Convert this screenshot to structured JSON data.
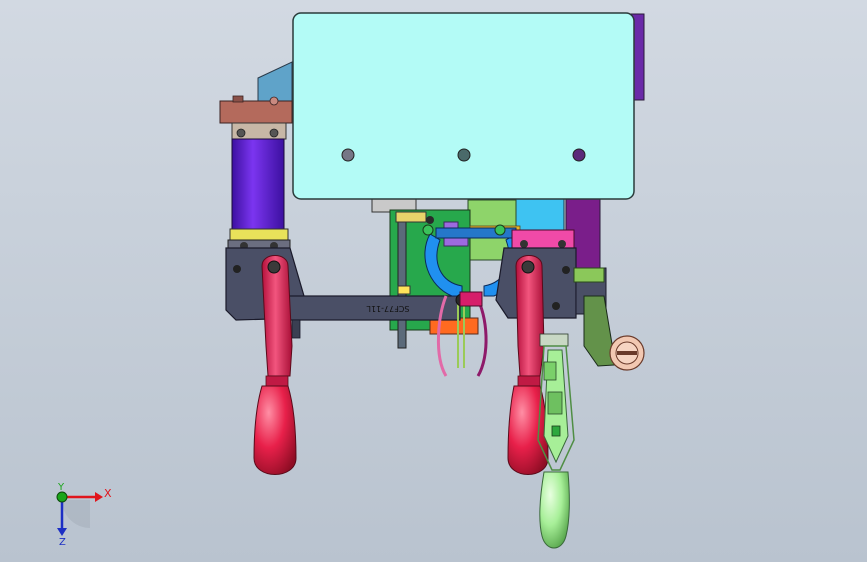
{
  "viewport": {
    "background_top": "#d2d9e2",
    "background_bottom": "#b9c3cf"
  },
  "part_label": "SCF77-11L",
  "triad": {
    "x_label": "X",
    "y_label": "Y",
    "z_label": "Z",
    "x_color": "#e0151c",
    "y_color": "#1aa51a",
    "z_color": "#1c2fc4"
  },
  "colors": {
    "main_plate": "#b3fbf6",
    "hole": "#767686",
    "cylinder": "#6b1fe0",
    "bracket_dark": "#4a4f66",
    "brown_cap": "#b46a5c",
    "handle_red": "#e6205a",
    "knob_red": "#e8204a",
    "green_handle": "#a7ef98",
    "pink_block": "#f04aa8",
    "blue_gripper": "#2090f0"
  }
}
